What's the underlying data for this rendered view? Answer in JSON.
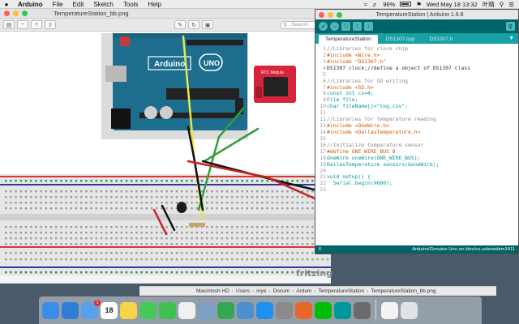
{
  "menubar": {
    "app_name": "Arduino",
    "items": [
      "File",
      "Edit",
      "Sketch",
      "Tools",
      "Help"
    ],
    "battery": "96%",
    "clock": "Wed May 18 13:32",
    "user": "叶晴"
  },
  "preview": {
    "title": "TemperatureStation_bb.png",
    "search_placeholder": "Search",
    "watermark": "fritzing",
    "breadboard_labels": {
      "arduino_brand": "Arduino",
      "uno": "UNO",
      "rtc": "RTC Module"
    }
  },
  "pathbar": {
    "items": [
      "Macintosh HD",
      "Users",
      "mye",
      "Docum",
      "Arduin",
      "TemperatureStation",
      "TemperatureStation_bb.png"
    ]
  },
  "arduino_ide": {
    "title": "TemperatureStation | Arduino 1.6.8",
    "tabs": [
      "TemperatureStation",
      "DS1307.cpp",
      "DS1307.h"
    ],
    "code_lines": [
      {
        "n": "1",
        "t": "//Libraries for clock chip",
        "c": "comment"
      },
      {
        "n": "2",
        "t": "#include <Wire.h>",
        "c": "kw"
      },
      {
        "n": "3",
        "t": "#include \"DS1307.h\"",
        "c": "kw"
      },
      {
        "n": "4",
        "t": "DS1307 clock;//define a object of DS1307 class",
        "c": "code"
      },
      {
        "n": "5",
        "t": "",
        "c": "code"
      },
      {
        "n": "6",
        "t": "//Libraries for SD writing",
        "c": "comment"
      },
      {
        "n": "7",
        "t": "#include <SD.h>",
        "c": "kw"
      },
      {
        "n": "8",
        "t": "const int cs=4;",
        "c": "ty"
      },
      {
        "n": "9",
        "t": "File file;",
        "c": "ty"
      },
      {
        "n": "10",
        "t": "char fileName[]=\"log.csv\";",
        "c": "ty"
      },
      {
        "n": "11",
        "t": "",
        "c": "code"
      },
      {
        "n": "12",
        "t": "//Libraries for temperature reading",
        "c": "comment"
      },
      {
        "n": "13",
        "t": "#include <OneWire.h>",
        "c": "kw"
      },
      {
        "n": "14",
        "t": "#include <DallasTemperature.h>",
        "c": "kw"
      },
      {
        "n": "15",
        "t": "",
        "c": "code"
      },
      {
        "n": "16",
        "t": "//Initialize temperature sensor",
        "c": "comment"
      },
      {
        "n": "17",
        "t": "#define ONE_WIRE_BUS 8",
        "c": "kw"
      },
      {
        "n": "18",
        "t": "OneWire oneWire(ONE_WIRE_BUS);",
        "c": "ty"
      },
      {
        "n": "19",
        "t": "DallasTemperature sensors(&oneWire);",
        "c": "ty"
      },
      {
        "n": "20",
        "t": "",
        "c": "code"
      },
      {
        "n": "21",
        "t": "void setup() {",
        "c": "ty"
      },
      {
        "n": "22",
        "t": "  Serial.begin(9600);",
        "c": "ty"
      },
      {
        "n": "23",
        "t": "",
        "c": "code"
      }
    ],
    "status_line": "6",
    "status_board": "Arduino/Genuino Uno on /dev/cu.usbmodem1411"
  },
  "dock": {
    "calendar_day": "18",
    "mail_badge": "1",
    "icons": [
      {
        "name": "finder-icon",
        "color": "#3b8ee8"
      },
      {
        "name": "safari-icon",
        "color": "#2f7fd6"
      },
      {
        "name": "mail-icon",
        "color": "#5aa0e8"
      },
      {
        "name": "calendar-icon",
        "color": "#ffffff"
      },
      {
        "name": "notes-icon",
        "color": "#f5d547"
      },
      {
        "name": "messages-icon",
        "color": "#46c85a"
      },
      {
        "name": "facetime-icon",
        "color": "#3fbf4f"
      },
      {
        "name": "photos-icon",
        "color": "#f0f0f0"
      },
      {
        "name": "preview-icon",
        "color": "#7d9fc7"
      },
      {
        "name": "numbers-icon",
        "color": "#33a853"
      },
      {
        "name": "keynote-icon",
        "color": "#4d8fd1"
      },
      {
        "name": "appstore-icon",
        "color": "#1f8ff0"
      },
      {
        "name": "system-preferences-icon",
        "color": "#8a8a8a"
      },
      {
        "name": "firefox-icon",
        "color": "#e8682c"
      },
      {
        "name": "iqiyi-icon",
        "color": "#00be06"
      },
      {
        "name": "arduino-icon",
        "color": "#00979c"
      },
      {
        "name": "dictionary-icon",
        "color": "#6b6b6b"
      },
      {
        "name": "document-icon",
        "color": "#f3f3f3"
      },
      {
        "name": "trash-icon",
        "color": "#dfe3e6"
      }
    ]
  }
}
